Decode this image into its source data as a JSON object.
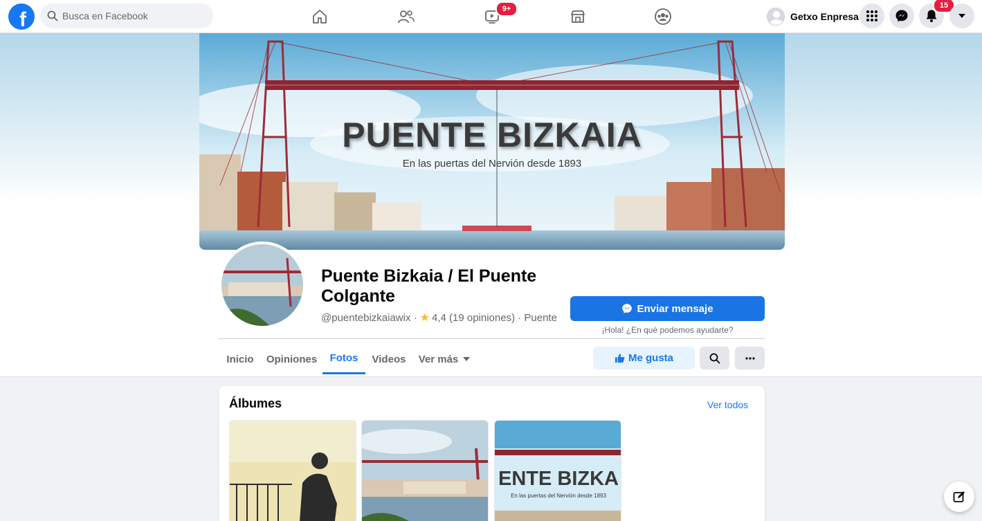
{
  "topbar": {
    "logo": "f",
    "search_placeholder": "Busca en Facebook",
    "nav": [
      {
        "name": "home-icon",
        "badge": ""
      },
      {
        "name": "friends-icon",
        "badge": ""
      },
      {
        "name": "watch-icon",
        "badge": "9+"
      },
      {
        "name": "marketplace-icon",
        "badge": ""
      },
      {
        "name": "groups-icon",
        "badge": ""
      }
    ],
    "profile_name": "Getxo Enpresa",
    "notifications_badge": "15"
  },
  "cover": {
    "title": "PUENTE BIZKAIA",
    "subtitle": "En las puertas del Nervión desde 1893"
  },
  "page": {
    "name": "Puente Bizkaia / El Puente Colgante",
    "handle": "@puentebizkaiawix ·",
    "rating": "4,4 (19 opiniones) · Puente",
    "message_button": "Enviar mensaje",
    "message_hint": "¡Hola! ¿En qué podemos ayudarte?"
  },
  "tabs": [
    {
      "label": "Inicio",
      "active": false
    },
    {
      "label": "Opiniones",
      "active": false
    },
    {
      "label": "Fotos",
      "active": true
    },
    {
      "label": "Videos",
      "active": false
    },
    {
      "label": "Ver más",
      "active": false
    }
  ],
  "actions": {
    "like_label": "Me gusta"
  },
  "albums": {
    "title": "Álbumes",
    "see_all": "Ver todos",
    "album3_title": "ENTE BIZKA",
    "album3_subtitle": "En las puertas del Nervión desde 1893"
  },
  "colors": {
    "brand": "#1877f2",
    "badge": "#e41e3f"
  }
}
